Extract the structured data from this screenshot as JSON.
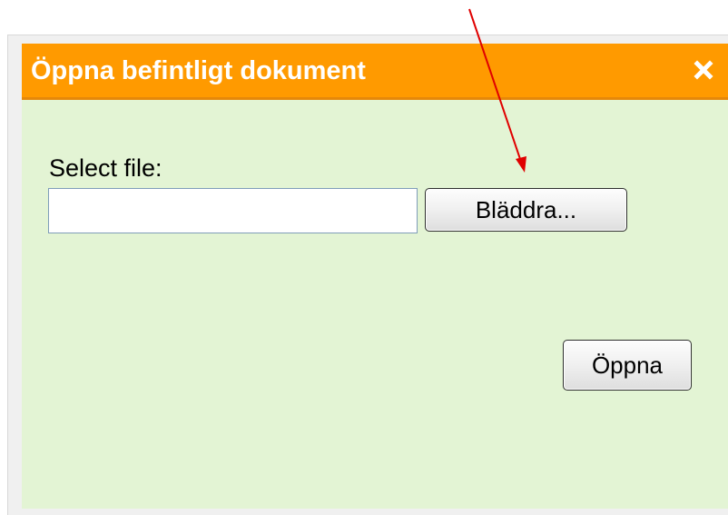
{
  "dialog": {
    "title": "Öppna befintligt dokument",
    "close_icon": "close-icon",
    "select_file_label": "Select file:",
    "file_input": {
      "value": "",
      "placeholder": ""
    },
    "browse_button_label": "Bläddra...",
    "open_button_label": "Öppna"
  },
  "colors": {
    "titlebar": "#ff9a00",
    "dialog_background": "#e3f4d4",
    "annotation_arrow": "#e00000"
  }
}
